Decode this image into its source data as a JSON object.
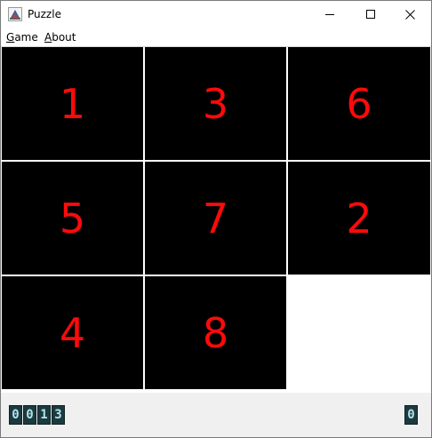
{
  "window": {
    "title": "Puzzle"
  },
  "menu": {
    "items": [
      {
        "label": "Game",
        "mnemonic": "G"
      },
      {
        "label": "About",
        "mnemonic": "A"
      }
    ]
  },
  "board": {
    "rows": 3,
    "cols": 3,
    "tiles": [
      "1",
      "3",
      "6",
      "5",
      "7",
      "2",
      "4",
      "8",
      ""
    ],
    "tile_color": "#000000",
    "number_color": "#ff0a0a",
    "empty_color": "#ffffff"
  },
  "status": {
    "moves_digits": [
      "0",
      "0",
      "1",
      "3"
    ],
    "right_digits": [
      "0"
    ]
  }
}
